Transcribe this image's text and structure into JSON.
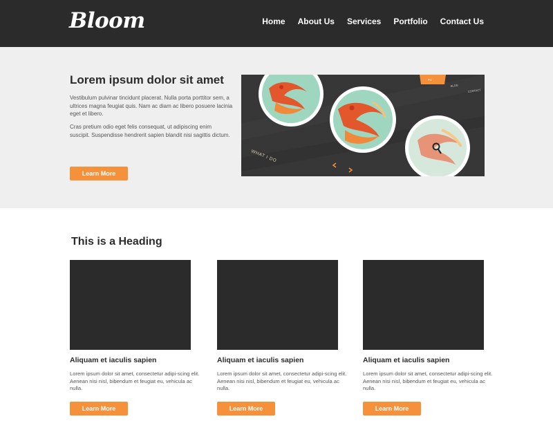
{
  "header": {
    "logo": "Bloom",
    "nav": [
      "Home",
      "About Us",
      "Services",
      "Portfolio",
      "Contact Us"
    ]
  },
  "hero": {
    "title": "Lorem ipsum dolor sit amet",
    "paragraph1": "Vestibulum pulvinar tincidunt placerat. Nulla porta porttitor sem, a ultrices magna feugiat quis. Nam ac diam ac libero posuere lacinia eget et libero.",
    "paragraph2": "Cras pretium odio eget felis consequat, ut adipiscing enim suscipit. Suspendisse hendrerit sapien blandit nisi sagittis dictum.",
    "button": "Learn More",
    "image": {
      "tag_text": "WHAT I DO",
      "menu_items": [
        "BLOG",
        "CONTACT"
      ],
      "accent": "#f4913a"
    }
  },
  "features": {
    "heading": "This is a Heading",
    "cards": [
      {
        "title": "Aliquam et iaculis sapien",
        "text": "Lorem ipsum dolor sit amet, consectetur adipi-scing elit. Aenean nisi nisl, bibendum et feugiat eu, vehicula ac nulla.",
        "button": "Learn More"
      },
      {
        "title": "Aliquam et iaculis sapien",
        "text": "Lorem ipsum dolor sit amet, consectetur adipi-scing elit. Aenean nisi nisl, bibendum et feugiat eu, vehicula ac nulla.",
        "button": "Learn More"
      },
      {
        "title": "Aliquam et iaculis sapien",
        "text": "Lorem ipsum dolor sit amet, consectetur adipi-scing elit. Aenean nisi nisl, bibendum et feugiat eu, vehicula ac nulla.",
        "button": "Learn More"
      }
    ]
  },
  "colors": {
    "header_bg": "#2b2b2b",
    "hero_bg": "#efefef",
    "accent": "#f4913a",
    "thumb": "#2b2b2b"
  }
}
